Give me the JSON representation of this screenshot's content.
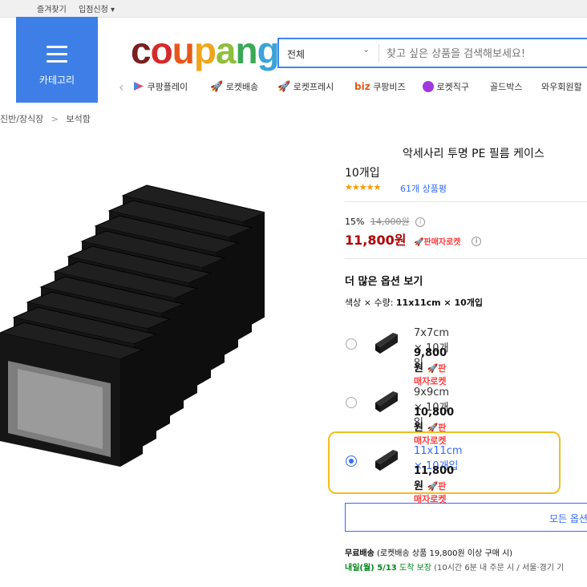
{
  "topbar": {
    "favorites": "즐겨찾기",
    "partner": "입점신청",
    "partner_caret": "▾"
  },
  "header": {
    "category_label": "카테고리",
    "logo_letters": [
      {
        "ch": "c",
        "color": "#7a1f1f"
      },
      {
        "ch": "o",
        "color": "#d52a2a"
      },
      {
        "ch": "u",
        "color": "#e8571c"
      },
      {
        "ch": "p",
        "color": "#f0a51b"
      },
      {
        "ch": "a",
        "color": "#8fbf3a"
      },
      {
        "ch": "n",
        "color": "#3aa855"
      },
      {
        "ch": "g",
        "color": "#3aa4d8"
      }
    ],
    "search": {
      "category": "전체",
      "caret": "⌄",
      "placeholder": "찾고 싶은 상품을 검색해보세요!"
    },
    "quick_links": {
      "prev": "‹",
      "play": "쿠팡플레이",
      "rocket_delivery": "로켓배송",
      "rocket_fresh": "로켓프레시",
      "biz_prefix": "biz",
      "biz": "쿠팡비즈",
      "rocket_direct": "로켓직구",
      "goldbox": "골드박스",
      "wow": "와우회원할"
    }
  },
  "breadcrumb": {
    "item1": "진반/장식장",
    "sep": ">",
    "item2": "보석함"
  },
  "product": {
    "title_line1": "악세사리 투명 PE 필름 케이스",
    "title_line2": "10개입",
    "rating_stars": "★★★★★",
    "rating": 5,
    "review_count": "61개 상품평",
    "discount_rate": "15%",
    "original_price": "14,000원",
    "sale_price": "11,800원",
    "seller_badge": "판매자로켓",
    "info_icon": "i"
  },
  "options": {
    "heading": "더 많은 옵션 보기",
    "selector_label": "색상 × 수량:",
    "selector_value": "11x11cm × 10개입",
    "items": [
      {
        "name": "7x7cm × 10개입",
        "price": "9,800원",
        "badge": "판매자로켓",
        "selected": false
      },
      {
        "name": "9x9cm × 10개입",
        "price": "10,800원",
        "badge": "판매자로켓",
        "selected": false
      },
      {
        "name": "11x11cm × 10개입",
        "price": "11,800원",
        "badge": "판매자로켓",
        "selected": true
      }
    ],
    "all_options_label": "모든 옵션"
  },
  "shipping": {
    "free_label": "무료배송",
    "free_cond": "(로켓배송 상품 19,800원 이상 구매 시)",
    "arrival": "내일(월) 5/13",
    "arrival_suffix": "도착 보장",
    "cutoff": "(10시간 6분 내 주문 시 / 서울·경기 기"
  },
  "colors": {
    "accent": "#346aff",
    "price_red": "#ae0000",
    "rocket_red": "#ff3c3c",
    "highlight": "#f0be22",
    "category_blue": "#3d7fe6"
  }
}
